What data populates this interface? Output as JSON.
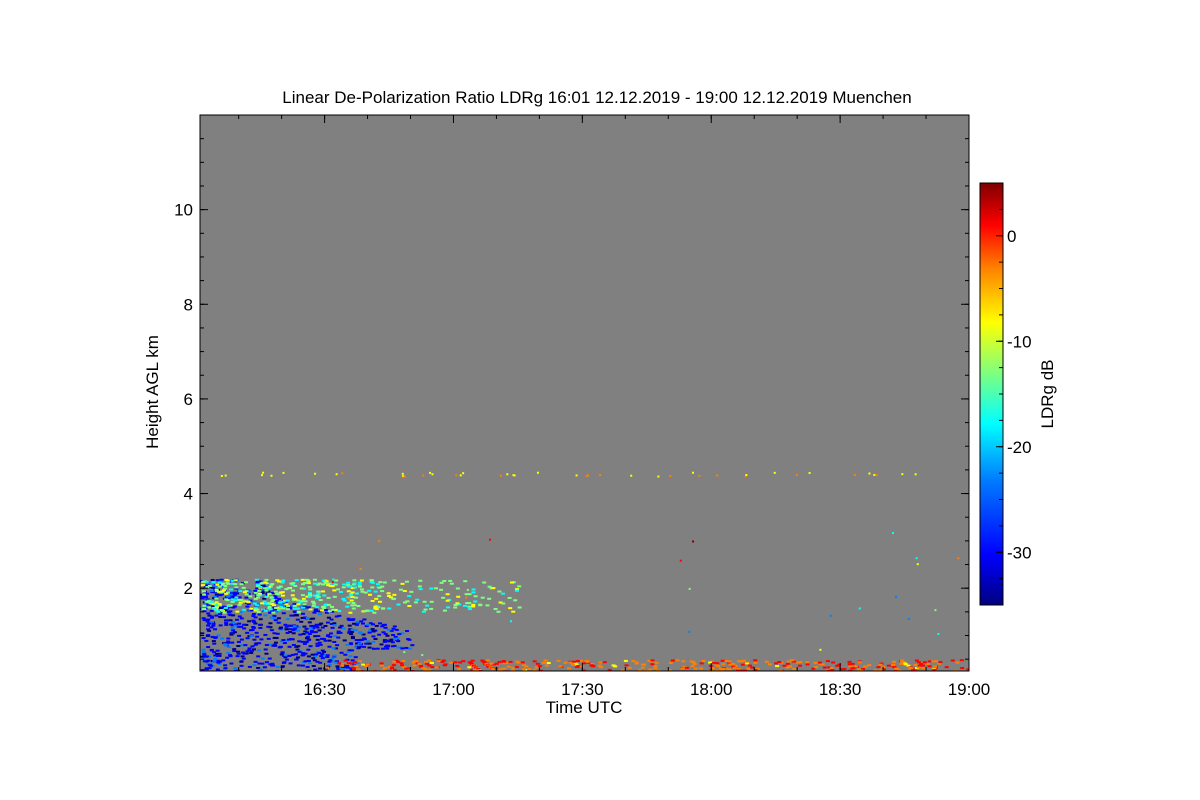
{
  "chart_data": {
    "type": "heatmap",
    "title": "Linear De-Polarization Ratio LDRg   16:01 12.12.2019 - 19:00 12.12.2019 Muenchen",
    "xlabel": "Time UTC",
    "ylabel": "Height AGL km",
    "xlim": [
      "16:01",
      "19:00"
    ],
    "ylim": [
      0.25,
      12.0
    ],
    "x_ticks": [
      "16:30",
      "17:00",
      "17:30",
      "18:00",
      "18:30",
      "19:00"
    ],
    "y_ticks": [
      2,
      4,
      6,
      8,
      10
    ],
    "colorbar": {
      "label": "LDRg dB",
      "range": [
        -35,
        5
      ],
      "ticks": [
        0,
        -10,
        -20,
        -30
      ]
    },
    "colors": {
      "background": "#808080",
      "colormap": [
        "#00007f",
        "#0000ff",
        "#007fff",
        "#00ffff",
        "#7fff7f",
        "#ffff00",
        "#ff7f00",
        "#ff0000",
        "#7f0000"
      ]
    },
    "features": [
      {
        "name": "boundary-layer blue region",
        "x_start": "16:01",
        "x_end": "16:50",
        "y_min": 0.25,
        "y_max": 2.2,
        "ldr_db": -30
      },
      {
        "name": "cyan/green layer top",
        "x_start": "16:01",
        "x_end": "17:15",
        "y_min": 1.5,
        "y_max": 2.2,
        "ldr_db": -15
      },
      {
        "name": "near-ground orange/red layer",
        "x_start": "16:30",
        "x_end": "19:00",
        "y_min": 0.25,
        "y_max": 0.5,
        "ldr_db": -3
      },
      {
        "name": "sparse speckles at ~4.4 km",
        "x_start": "16:05",
        "x_end": "18:50",
        "y": 4.4,
        "ldr_db": -8
      }
    ]
  }
}
